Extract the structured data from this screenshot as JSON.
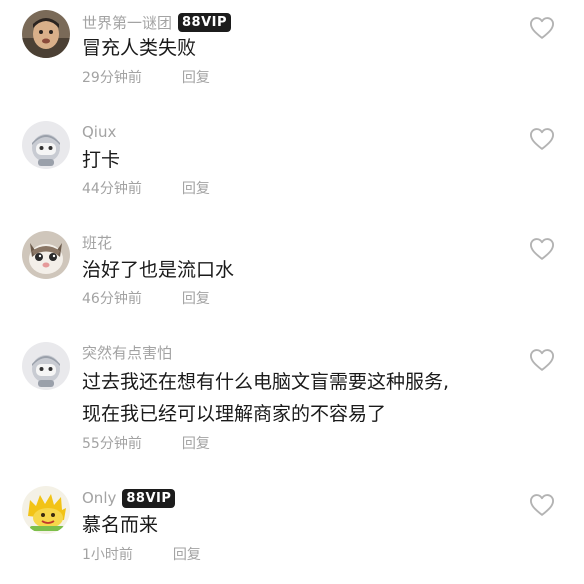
{
  "comments": [
    {
      "username": "世界第一谜团",
      "vip": "88VIP",
      "text": "冒充人类失败",
      "time": "29分钟前",
      "reply": "回复",
      "avatar": "photo-avatar"
    },
    {
      "username": "Qiux",
      "vip": "",
      "text": "打卡",
      "time": "44分钟前",
      "reply": "回复",
      "avatar": "default-avatar"
    },
    {
      "username": "班花",
      "vip": "",
      "text": "治好了也是流口水",
      "time": "46分钟前",
      "reply": "回复",
      "avatar": "cat-avatar"
    },
    {
      "username": "突然有点害怕",
      "vip": "",
      "text_lines": [
        "过去我还在想有什么电脑文盲需要这种服务,",
        "现在我已经可以理解商家的不容易了"
      ],
      "time": "55分钟前",
      "reply": "回复",
      "avatar": "default-avatar"
    },
    {
      "username": "Only",
      "vip": "88VIP",
      "text": "慕名而来",
      "time": "1小时前",
      "reply": "回复",
      "avatar": "cartoon-avatar"
    }
  ],
  "icons": {
    "like": "heart-outline-icon"
  },
  "colors": {
    "secondary_text": "#a3a3a3",
    "primary_text": "#1a1a1a",
    "vip_badge_bg": "#1c1c1c"
  }
}
